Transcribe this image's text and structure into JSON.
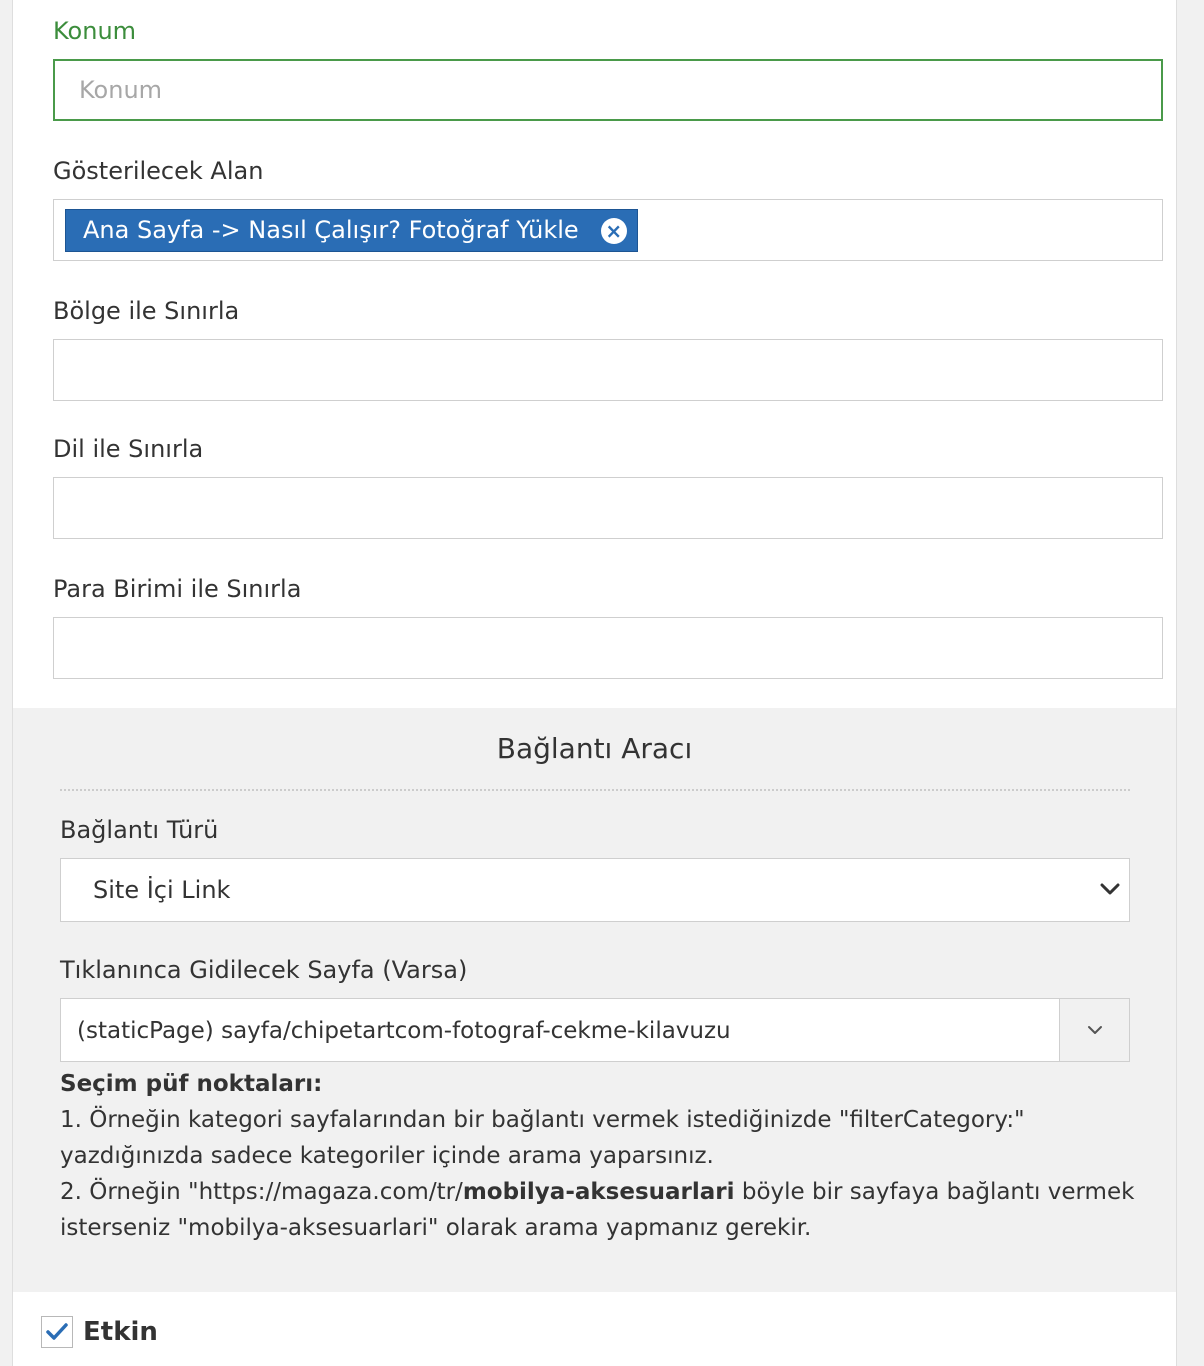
{
  "form": {
    "konum": {
      "label": "Konum",
      "placeholder": "Konum",
      "value": ""
    },
    "gosterilecek_alan": {
      "label": "Gösterilecek Alan",
      "tag": "Ana Sayfa -> Nasıl Çalışır? Fotoğraf Yükle",
      "tag_remove": "×"
    },
    "bolge": {
      "label": "Bölge ile Sınırla",
      "value": ""
    },
    "dil": {
      "label": "Dil ile Sınırla",
      "value": ""
    },
    "para_birimi": {
      "label": "Para Birimi ile Sınırla",
      "value": ""
    }
  },
  "link_tool": {
    "title": "Bağlantı Aracı",
    "link_type": {
      "label": "Bağlantı Türü",
      "selected": "Site İçi Link"
    },
    "target_page": {
      "label": "Tıklanınca Gidilecek Sayfa (Varsa)",
      "selected": "(staticPage) sayfa/chipetartcom-fotograf-cekme-kilavuzu"
    },
    "help": {
      "heading": "Seçim püf noktaları:",
      "line1": "1. Örneğin kategori sayfalarından bir bağlantı vermek istediğinizde \"filterCategory:\" yazdığınızda sadece kategoriler içinde arama yaparsınız.",
      "line2_pre": "2. Örneğin \"https://magaza.com/tr/",
      "line2_bold": "mobilya-aksesuarlari",
      "line2_post": " böyle bir sayfaya bağlantı vermek isterseniz \"mobilya-aksesuarlari\" olarak arama yapmanız gerekir."
    }
  },
  "active": {
    "label": "Etkin",
    "checked": true
  },
  "colors": {
    "label_green": "#3c8d3c",
    "field_green": "#4a9a4a",
    "tag_blue": "#2a6db5",
    "section_bg": "#f1f1f1",
    "check_blue": "#2a6db5"
  },
  "icons": {
    "tag_remove": "close-circle-icon",
    "select_arrow": "chevron-down-icon",
    "checkbox": "checkmark-icon"
  }
}
